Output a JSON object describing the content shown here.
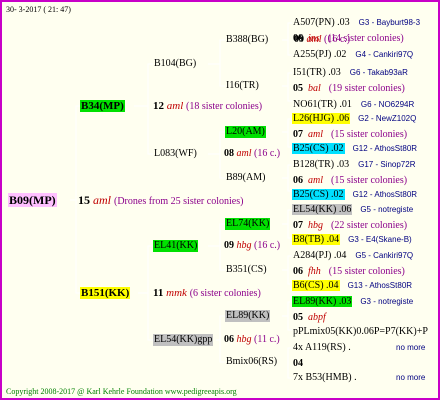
{
  "date": "30- 3-2017 ( 21: 47)",
  "footer": "Copyright 2008-2017 @ Karl Kehrle Foundation   www.pedigreeapis.org",
  "root": {
    "name": "B09(MP)",
    "num": "15",
    "race": "aml",
    "desc": "(Drones from 25 sister colonies)"
  },
  "mother": {
    "name": "B34(MP)",
    "num": "12",
    "race": "aml",
    "desc": "(18 sister colonies)"
  },
  "father": {
    "name": "B151(KK)",
    "num": "11",
    "race": "mmk",
    "desc": "(6 sister colonies)"
  },
  "mm": {
    "name": "B104(BG)"
  },
  "mf": {
    "name": "L083(WF)",
    "num": "08",
    "race": "aml",
    "desc": "(16 c.)"
  },
  "fm": {
    "name": "EL41(KK)",
    "num": "09",
    "race": "hbg",
    "desc": "(16 c.)"
  },
  "ff": {
    "name": "EL54(KK)gpp",
    "num": "06",
    "race": "hbg",
    "desc": "(11 c.)"
  },
  "l3": [
    {
      "name": "B388(BG)",
      "num": "09",
      "race": "aml",
      "desc": "(16 c.)"
    },
    {
      "name": "I16(TR)"
    },
    {
      "name": "L20(AM)"
    },
    {
      "name": "B89(AM)"
    },
    {
      "name": "EL74(KK)"
    },
    {
      "name": "B351(CS)"
    },
    {
      "name": "EL89(KK)"
    },
    {
      "name": "Bmix06(RS)"
    }
  ],
  "rows": [
    {
      "a": "A507(PN) .03",
      "b": "G3 - Bayburt98-3"
    },
    {
      "a": "06",
      "r": "ins",
      "b": "(14 sister colonies)"
    },
    {
      "a": "A255(PJ) .02",
      "b": "G4 - Cankiri97Q"
    },
    {
      "a": "I51(TR) .03",
      "b": "G6 - Takab93aR"
    },
    {
      "a": "05",
      "r": "bal",
      "b": "(19 sister colonies)"
    },
    {
      "a": "NO61(TR) .01",
      "b": "G6 - NO6294R"
    },
    {
      "a": "L26(HJG) .06",
      "b": "G2 - NewZ102Q"
    },
    {
      "a": "07",
      "r": "aml",
      "b": "(15 sister colonies)"
    },
    {
      "a": "B25(CS) .02",
      "b": "G12 - AthosSt80R"
    },
    {
      "a": "B128(TR) .03",
      "b": "G17 - Sinop72R"
    },
    {
      "a": "06",
      "r": "aml",
      "b": "(15 sister colonies)"
    },
    {
      "a": "B25(CS) .02",
      "b": "G12 - AthosSt80R"
    },
    {
      "a": "EL54(KK) .06",
      "b": "G5 - notregiste"
    },
    {
      "a": "07",
      "r": "hbg",
      "b": "(22 sister colonies)"
    },
    {
      "a": "B8(TB) .04",
      "b": "G3 - E4(Skane-B)"
    },
    {
      "a": "A284(PJ) .04",
      "b": "G5 - Cankiri97Q"
    },
    {
      "a": "06",
      "r": "fhh",
      "b": "(15 sister colonies)"
    },
    {
      "a": "B6(CS) .04",
      "b": "G13 - AthosSt80R"
    },
    {
      "a": "EL89(KK) .03",
      "b": "G3 - notregiste"
    },
    {
      "a": "05",
      "r": "abpf",
      "b": ""
    },
    {
      "a": "pPLmix05(KK)0.06P=P7(KK)+P",
      "b": ""
    },
    {
      "a": "4x A119(RS) .",
      "b": "no more"
    },
    {
      "a": "04",
      "r": "",
      "b": ""
    },
    {
      "a": "7x B53(HMB) .",
      "b": "no more"
    }
  ]
}
